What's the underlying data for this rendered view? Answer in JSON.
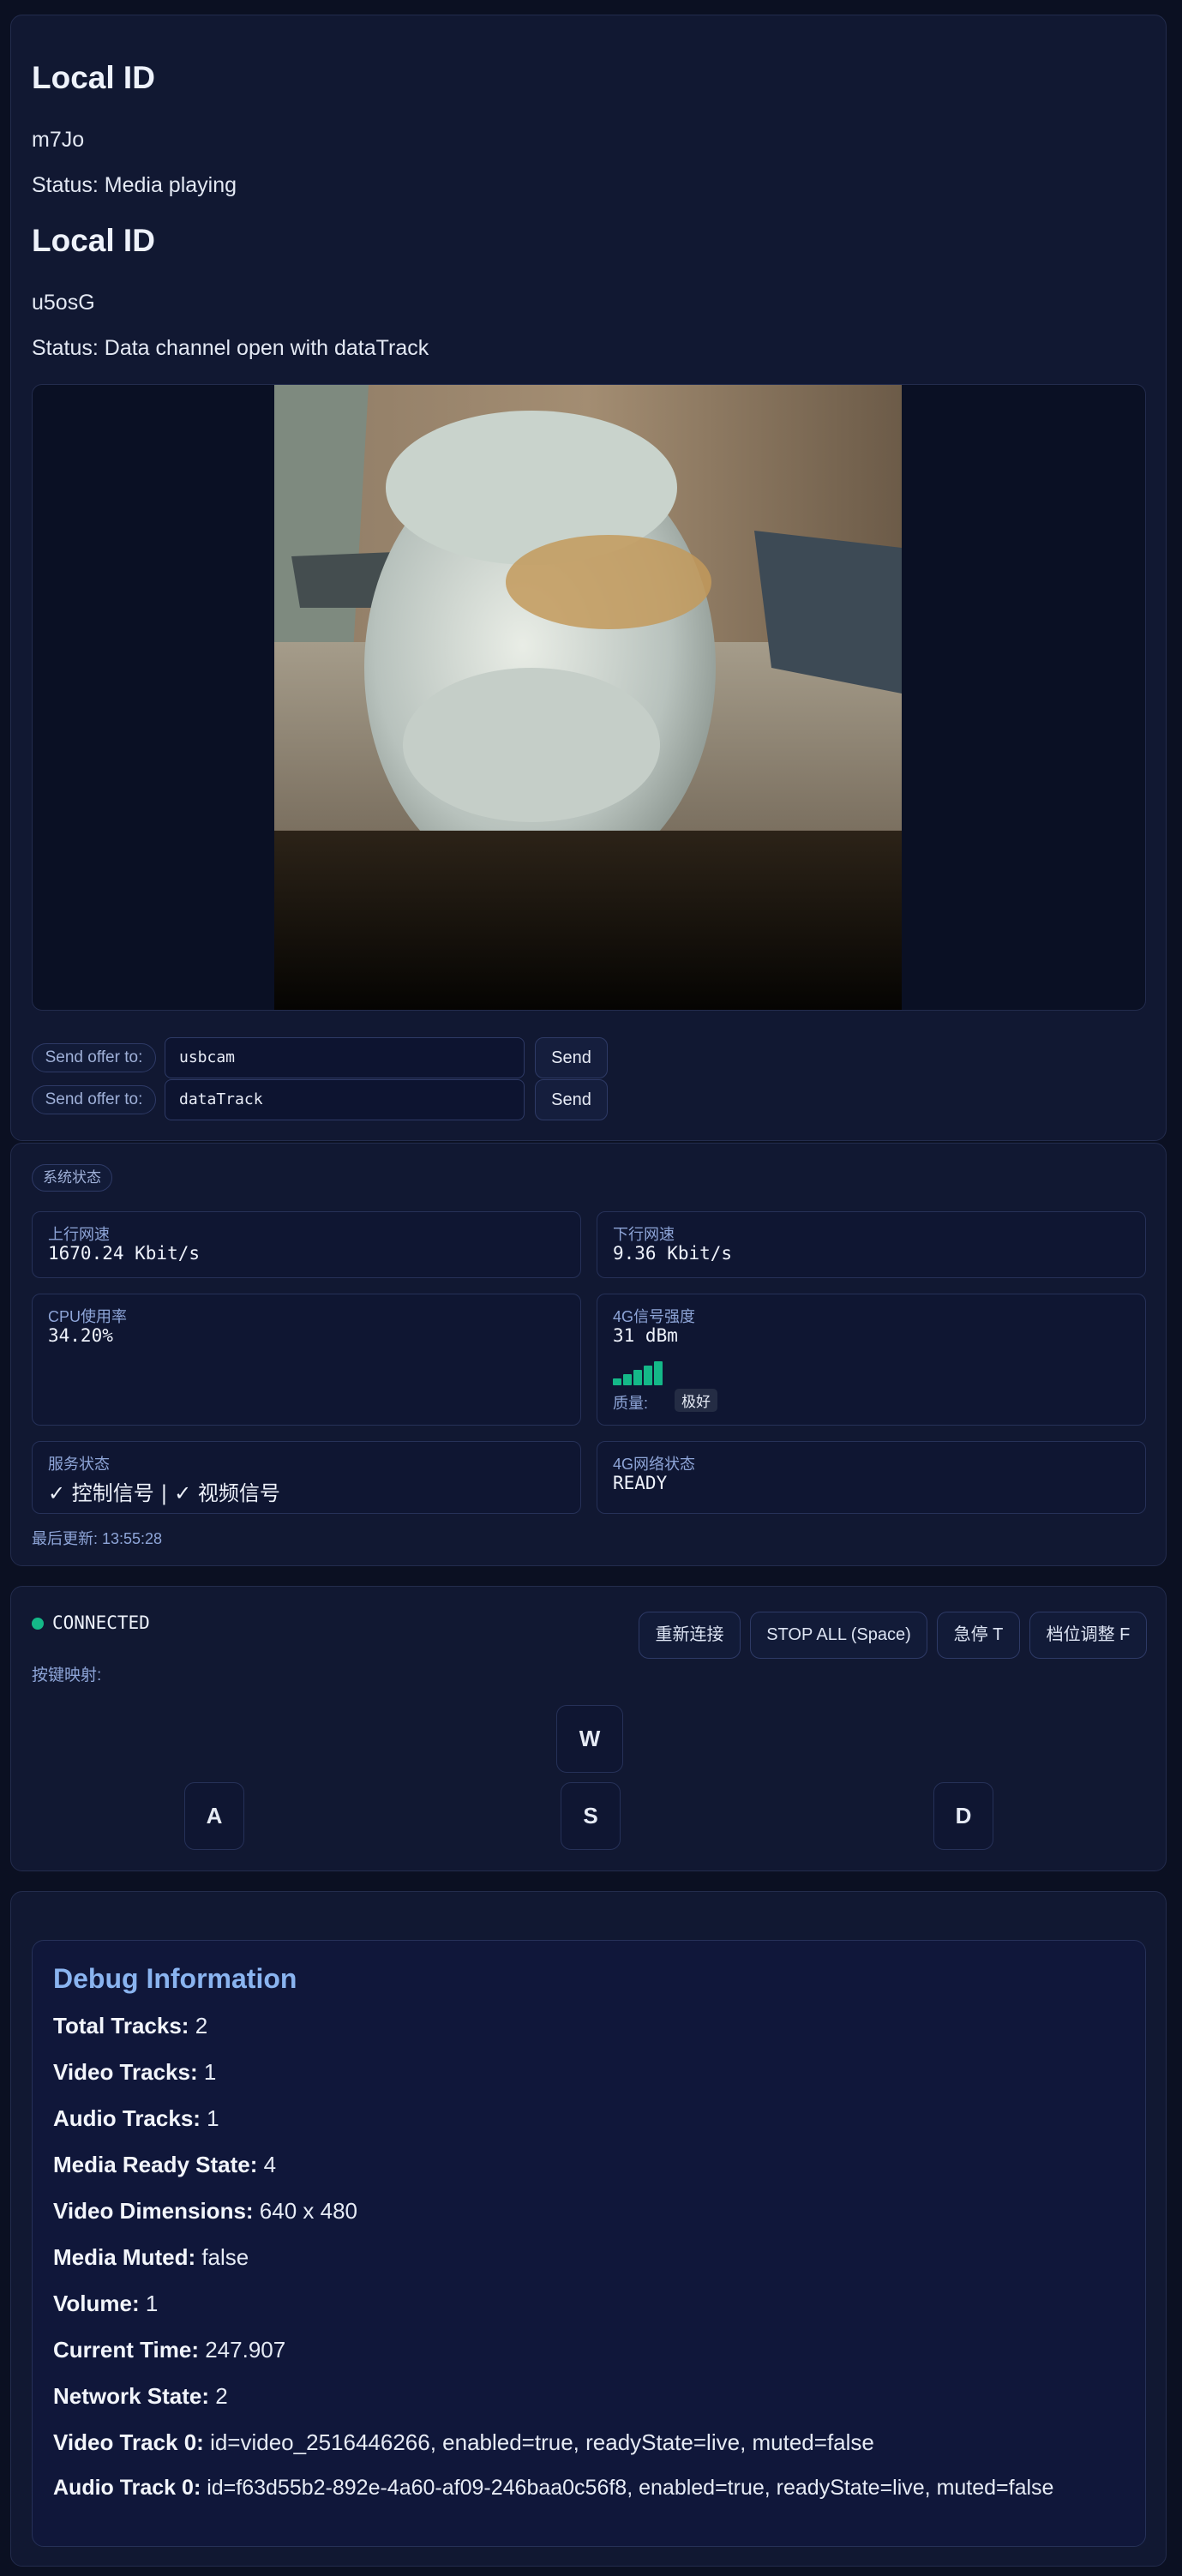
{
  "peers": [
    {
      "title": "Local ID",
      "id": "m7Jo",
      "status": "Status: Media playing"
    },
    {
      "title": "Local ID",
      "id": "u5osG",
      "status": "Status: Data channel open with dataTrack"
    }
  ],
  "offers": [
    {
      "label": "Send offer to:",
      "value": "usbcam",
      "send": "Send"
    },
    {
      "label": "Send offer to:",
      "value": "dataTrack",
      "send": "Send"
    }
  ],
  "system_status": {
    "title": "系统状态",
    "upload": {
      "label": "上行网速",
      "value": "1670.24 Kbit/s"
    },
    "download": {
      "label": "下行网速",
      "value": "9.36 Kbit/s"
    },
    "cpu": {
      "label": "CPU使用率",
      "value": "34.20%"
    },
    "signal": {
      "label": "4G信号强度",
      "value": "31 dBm",
      "bars": 5,
      "bars_total": 5,
      "quality_label": "质量:",
      "quality": "极好"
    },
    "service": {
      "label": "服务状态",
      "value": "✓ 控制信号 | ✓ 视频信号"
    },
    "network": {
      "label": "4G网络状态",
      "value": "READY"
    },
    "updated": "最后更新: 13:55:28"
  },
  "control": {
    "connection": "CONNECTED",
    "status_color": "#14b888",
    "buttons": {
      "reconnect": "重新连接",
      "stop_all": "STOP ALL (Space)",
      "emergency": "急停 T",
      "gear": "档位调整 F"
    },
    "key_map_label": "按键映射:",
    "keys": {
      "w": "W",
      "a": "A",
      "s": "S",
      "d": "D"
    }
  },
  "debug": {
    "title": "Debug Information",
    "rows": [
      {
        "k": "Total Tracks:",
        "v": " 2"
      },
      {
        "k": "Video Tracks:",
        "v": " 1"
      },
      {
        "k": "Audio Tracks:",
        "v": " 1"
      },
      {
        "k": "Media Ready State:",
        "v": " 4"
      },
      {
        "k": "Video Dimensions:",
        "v": " 640 x 480"
      },
      {
        "k": "Media Muted:",
        "v": " false"
      },
      {
        "k": "Volume:",
        "v": " 1"
      },
      {
        "k": "Current Time:",
        "v": " 247.907"
      },
      {
        "k": "Network State:",
        "v": " 2"
      },
      {
        "k": "Video Track 0:",
        "v": " id=video_2516446266, enabled=true, readyState=live, muted=false"
      },
      {
        "k": "Audio Track 0:",
        "v": " id=f63d55b2-892e-4a60-af09-246baa0c56f8, enabled=true, readyState=live, muted=false"
      }
    ]
  }
}
